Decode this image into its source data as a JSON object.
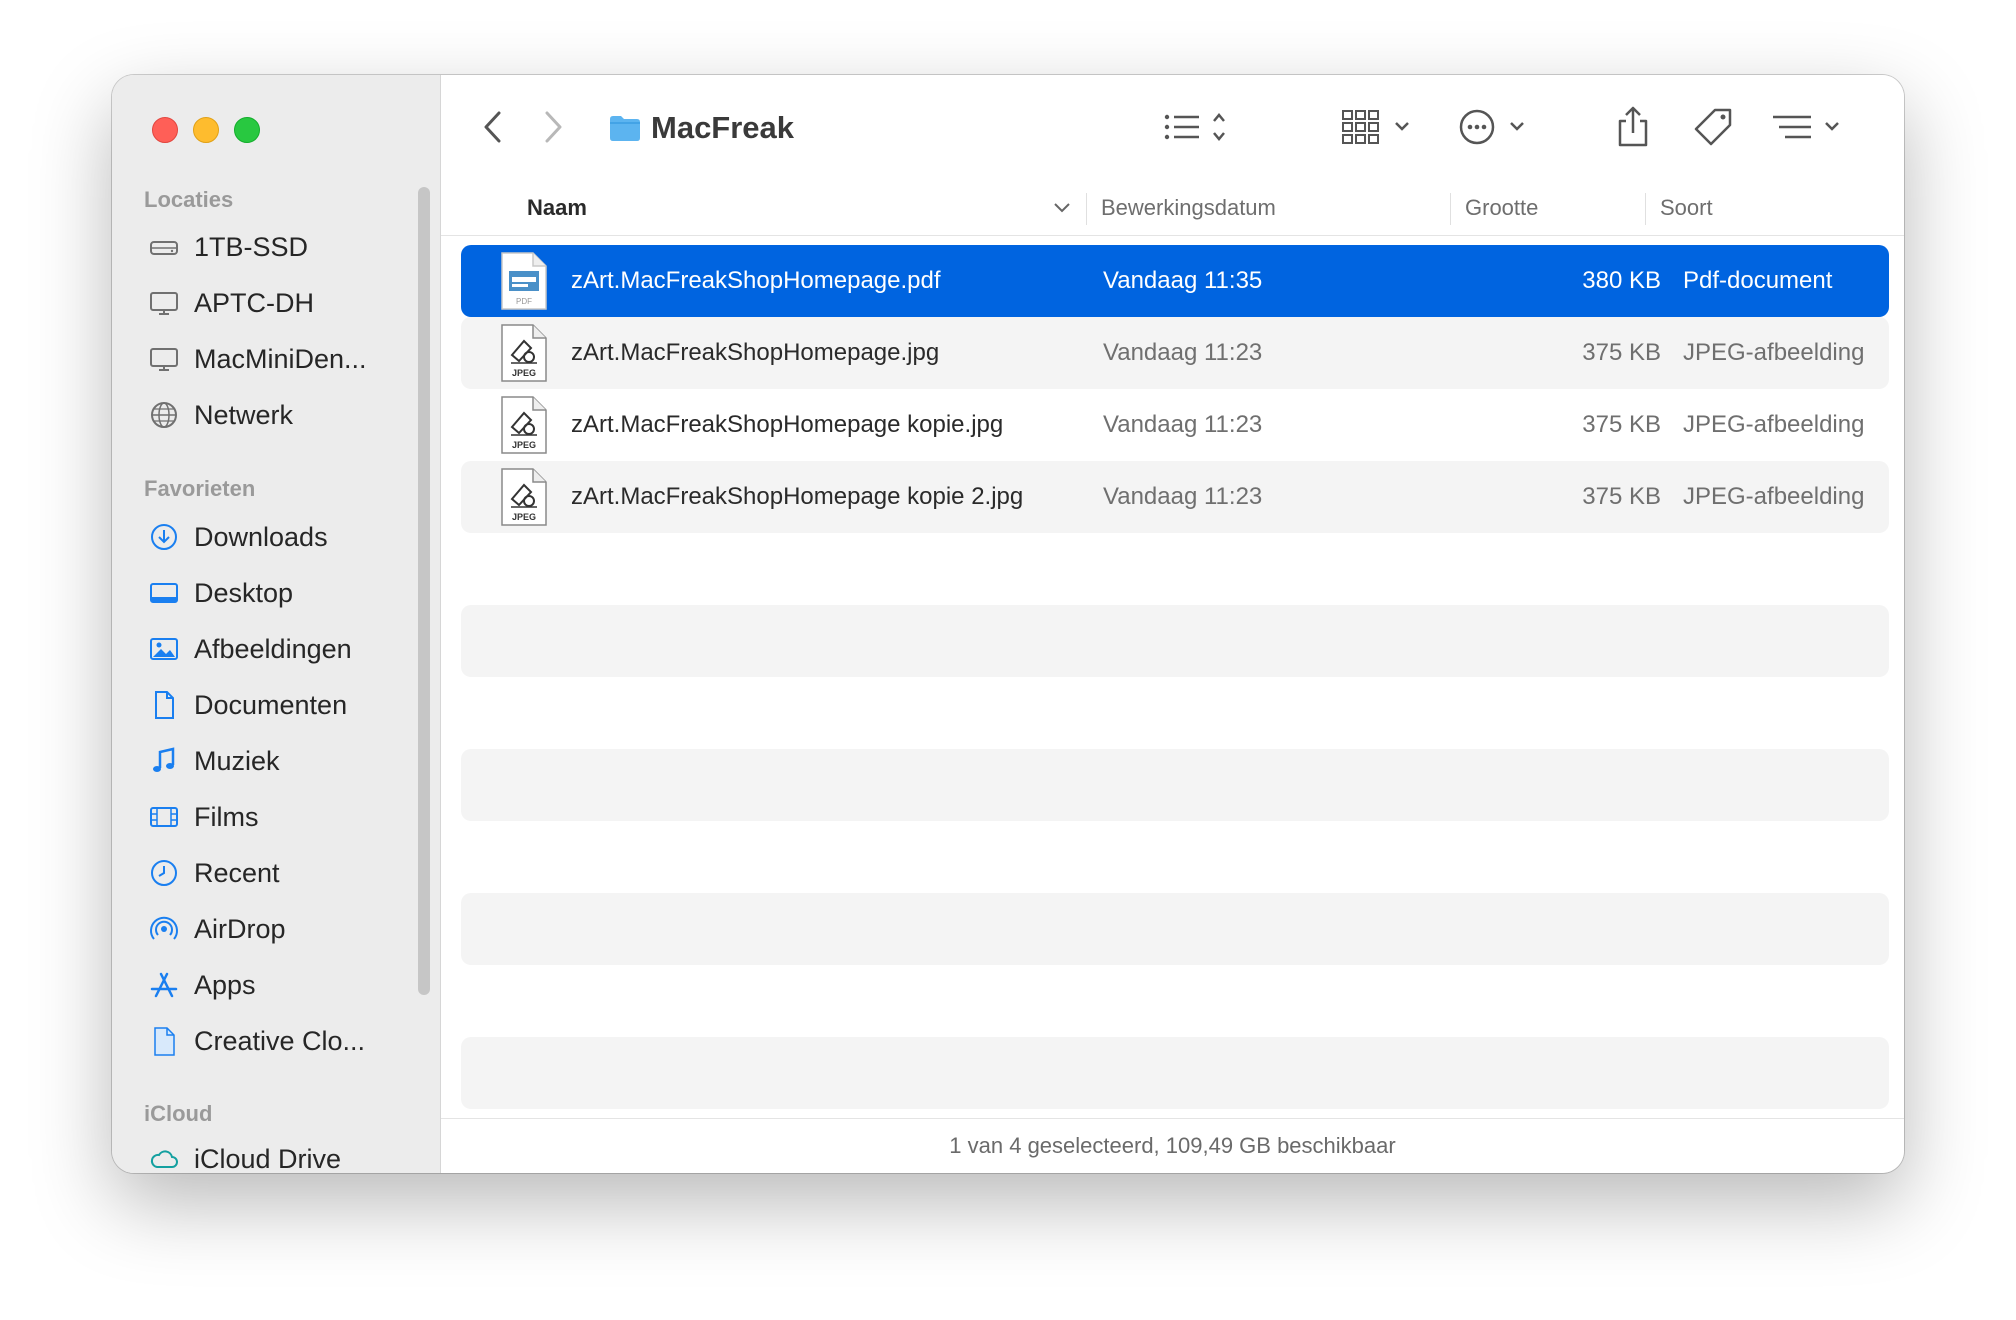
{
  "window": {
    "title": "MacFreak"
  },
  "sidebar": {
    "sections": [
      {
        "label": "Locaties",
        "items": [
          {
            "label": "1TB-SSD",
            "icon": "drive-icon"
          },
          {
            "label": "APTC-DH",
            "icon": "display-icon"
          },
          {
            "label": "MacMiniDen...",
            "icon": "display-icon"
          },
          {
            "label": "Netwerk",
            "icon": "globe-icon"
          }
        ]
      },
      {
        "label": "Favorieten",
        "items": [
          {
            "label": "Downloads",
            "icon": "download-icon"
          },
          {
            "label": "Desktop",
            "icon": "desktop-icon"
          },
          {
            "label": "Afbeeldingen",
            "icon": "photo-icon"
          },
          {
            "label": "Documenten",
            "icon": "document-icon"
          },
          {
            "label": "Muziek",
            "icon": "music-icon"
          },
          {
            "label": "Films",
            "icon": "film-icon"
          },
          {
            "label": "Recent",
            "icon": "clock-icon"
          },
          {
            "label": "AirDrop",
            "icon": "airdrop-icon"
          },
          {
            "label": "Apps",
            "icon": "apps-icon"
          },
          {
            "label": "Creative Clo...",
            "icon": "file-icon"
          }
        ]
      },
      {
        "label": "iCloud",
        "items": [
          {
            "label": "iCloud Drive",
            "icon": "cloud-icon"
          }
        ]
      }
    ]
  },
  "columns": {
    "name": "Naam",
    "date": "Bewerkingsdatum",
    "size": "Grootte",
    "kind": "Soort"
  },
  "files": [
    {
      "name": "zArt.MacFreakShopHomepage.pdf",
      "date": "Vandaag 11:35",
      "size": "380 KB",
      "kind": "Pdf-document",
      "icon_label": "PDF",
      "selected": true
    },
    {
      "name": "zArt.MacFreakShopHomepage.jpg",
      "date": "Vandaag 11:23",
      "size": "375 KB",
      "kind": "JPEG-afbeelding",
      "icon_label": "JPEG",
      "selected": false
    },
    {
      "name": "zArt.MacFreakShopHomepage kopie.jpg",
      "date": "Vandaag 11:23",
      "size": "375 KB",
      "kind": "JPEG-afbeelding",
      "icon_label": "JPEG",
      "selected": false
    },
    {
      "name": "zArt.MacFreakShopHomepage kopie 2.jpg",
      "date": "Vandaag 11:23",
      "size": "375 KB",
      "kind": "JPEG-afbeelding",
      "icon_label": "JPEG",
      "selected": false
    }
  ],
  "status": {
    "text": "1 van 4 geselecteerd, 109,49 GB beschikbaar"
  },
  "colors": {
    "accent": "#0064e0",
    "sidebar_icon": "#1a7ff0",
    "folder": "#5cb4f0"
  }
}
